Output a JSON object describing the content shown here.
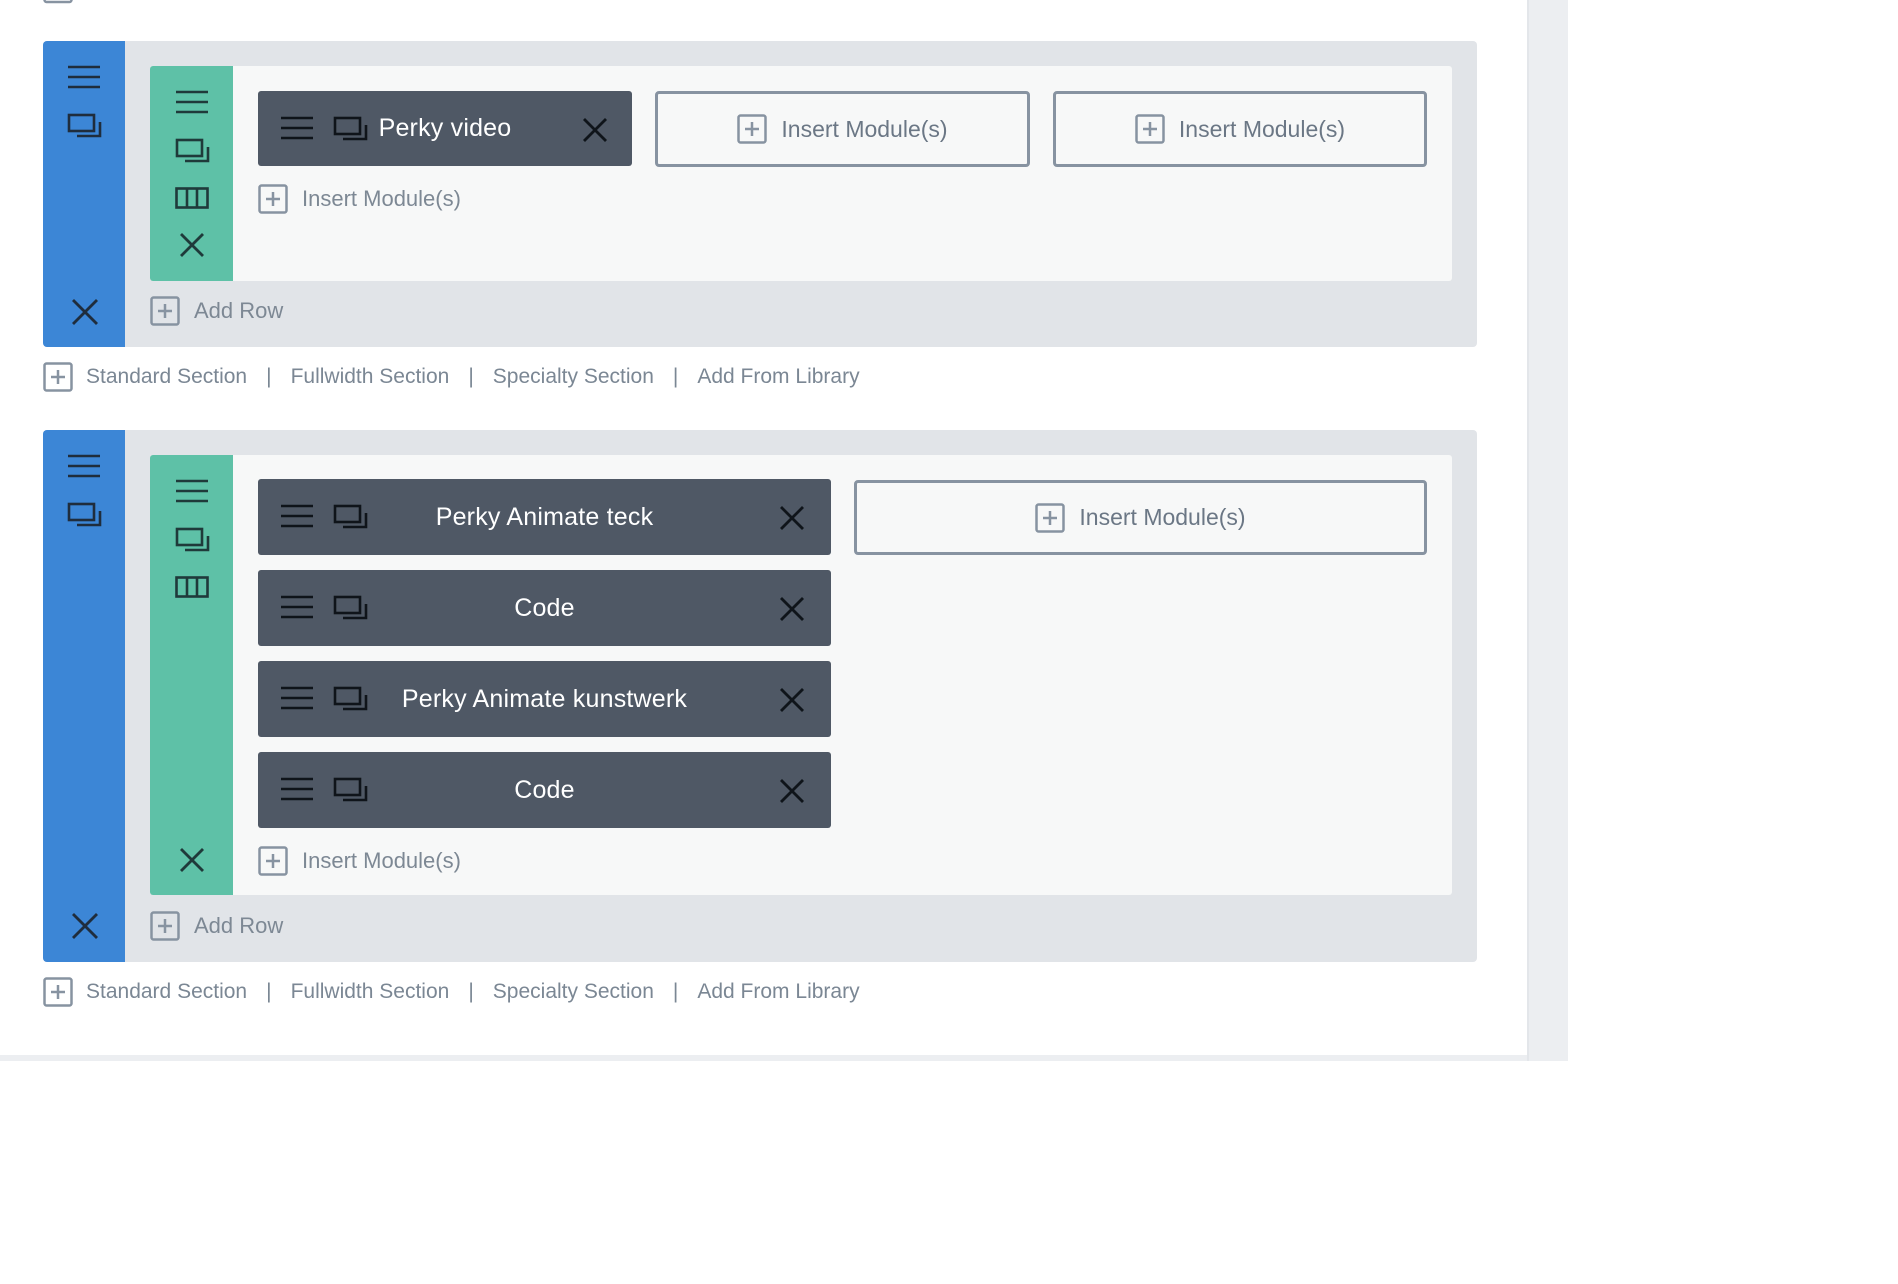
{
  "colors": {
    "section_bar": "#3c86d6",
    "row_bar": "#5ec1a7",
    "module_bg": "#4f5865",
    "section_bg": "#e1e4e8",
    "row_bg": "#f7f8f8"
  },
  "icons": {
    "move": "hamburger-icon",
    "duplicate": "duplicate-icon",
    "columns": "columns-icon",
    "delete": "close-icon",
    "add": "plus-square-icon"
  },
  "sections": [
    {
      "add_row_label": "Add Row",
      "row": {
        "columns": [
          {
            "modules": [
              "Perky video"
            ],
            "insert_label": "Insert Module(s)"
          },
          {
            "insert_label": "Insert Module(s)"
          },
          {
            "insert_label": "Insert Module(s)"
          }
        ]
      },
      "footer_links": [
        "Standard Section",
        "Fullwidth Section",
        "Specialty Section",
        "Add From Library"
      ]
    },
    {
      "add_row_label": "Add Row",
      "row": {
        "columns": [
          {
            "modules": [
              "Perky Animate teck",
              "Code",
              "Perky Animate kunstwerk",
              "Code"
            ],
            "insert_label": "Insert Module(s)"
          },
          {
            "insert_label": "Insert Module(s)"
          }
        ]
      },
      "footer_links": [
        "Standard Section",
        "Fullwidth Section",
        "Specialty Section",
        "Add From Library"
      ]
    }
  ]
}
